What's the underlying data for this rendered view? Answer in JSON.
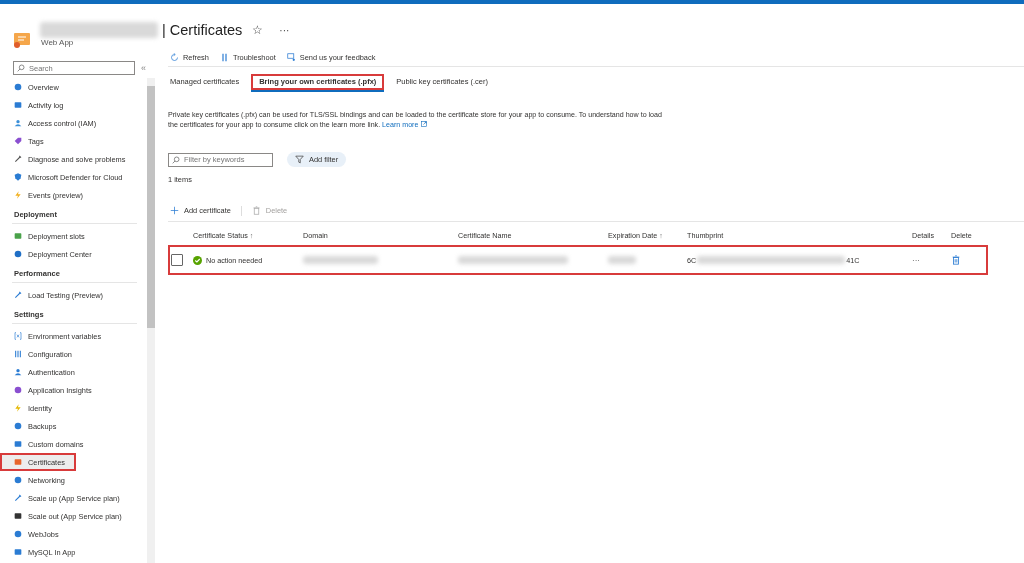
{
  "header": {
    "resource_name_redacted": true,
    "title": "| Certificates",
    "subtitle": "Web App",
    "favorite_icon": "☆",
    "more": "···"
  },
  "sidebar": {
    "search": {
      "placeholder": "Search"
    },
    "collapse": "«",
    "items": [
      {
        "label": "Overview",
        "selected": false,
        "highlighted": false
      },
      {
        "label": "Activity log",
        "selected": false,
        "highlighted": false
      },
      {
        "label": "Access control (IAM)",
        "selected": false,
        "highlighted": false
      },
      {
        "label": "Tags",
        "selected": false,
        "highlighted": false
      },
      {
        "label": "Diagnose and solve problems",
        "selected": false,
        "highlighted": false
      },
      {
        "label": "Microsoft Defender for Cloud",
        "selected": false,
        "highlighted": false
      },
      {
        "label": "Events (preview)",
        "selected": false,
        "highlighted": false
      }
    ],
    "sections": [
      {
        "title": "Deployment",
        "items": [
          {
            "label": "Deployment slots",
            "selected": false,
            "highlighted": false
          },
          {
            "label": "Deployment Center",
            "selected": false,
            "highlighted": false
          }
        ]
      },
      {
        "title": "Performance",
        "items": [
          {
            "label": "Load Testing (Preview)",
            "selected": false,
            "highlighted": false
          }
        ]
      },
      {
        "title": "Settings",
        "items": [
          {
            "label": "Environment variables",
            "selected": false,
            "highlighted": false
          },
          {
            "label": "Configuration",
            "selected": false,
            "highlighted": false
          },
          {
            "label": "Authentication",
            "selected": false,
            "highlighted": false
          },
          {
            "label": "Application Insights",
            "selected": false,
            "highlighted": false
          },
          {
            "label": "Identity",
            "selected": false,
            "highlighted": false
          },
          {
            "label": "Backups",
            "selected": false,
            "highlighted": false
          },
          {
            "label": "Custom domains",
            "selected": false,
            "highlighted": false
          },
          {
            "label": "Certificates",
            "selected": true,
            "highlighted": true
          },
          {
            "label": "Networking",
            "selected": false,
            "highlighted": false
          },
          {
            "label": "Scale up (App Service plan)",
            "selected": false,
            "highlighted": false
          },
          {
            "label": "Scale out (App Service plan)",
            "selected": false,
            "highlighted": false
          },
          {
            "label": "WebJobs",
            "selected": false,
            "highlighted": false
          },
          {
            "label": "MySQL In App",
            "selected": false,
            "highlighted": false
          }
        ]
      }
    ]
  },
  "toolbar": [
    "Refresh",
    "Troubleshoot",
    "Send us your feedback"
  ],
  "tabs": [
    {
      "label": "Managed certificates",
      "selected": false,
      "highlighted": false
    },
    {
      "label": "Bring your own certificates (.pfx)",
      "selected": true,
      "highlighted": true
    },
    {
      "label": "Public key certificates (.cer)",
      "selected": false,
      "highlighted": false
    }
  ],
  "description": "Private key certificates (.pfx) can be used for TLS/SSL bindings and can be loaded to the certificate store for your app to consume. To understand how to load the certificates for your app to consume click on the learn more link.",
  "learn_more": "Learn more",
  "learn_more_external": true,
  "filter": {
    "placeholder": "Filter by keywords",
    "add_filter": "Add filter"
  },
  "item_count": "1 items",
  "actions": [
    {
      "label": "Add certificate",
      "disabled": false
    },
    {
      "label": "Delete",
      "disabled": true
    }
  ],
  "table": {
    "columns": [
      {
        "label": "Certificate Status",
        "sortable": true
      },
      {
        "label": "Domain",
        "sortable": false
      },
      {
        "label": "Certificate Name",
        "sortable": false
      },
      {
        "label": "Expiration Date",
        "sortable": true
      },
      {
        "label": "Thumbprint",
        "sortable": false
      },
      {
        "label": "Details",
        "sortable": false
      },
      {
        "label": "Delete",
        "sortable": false
      }
    ],
    "sort_icon": "↑",
    "rows": [
      {
        "checked": false,
        "highlighted": true,
        "status": "No action needed",
        "thumbprint_start": "6C",
        "thumbprint_end": "41C",
        "details": "···"
      }
    ]
  }
}
